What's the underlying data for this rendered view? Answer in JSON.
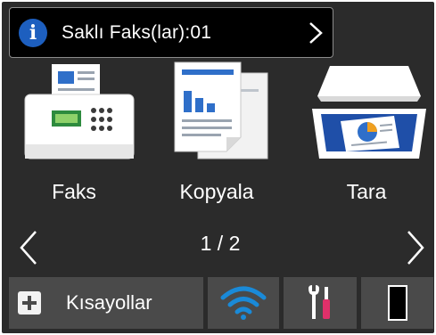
{
  "notification": {
    "icon": "info-icon",
    "text": "Saklı Faks(lar):01",
    "chevron": "chevron-right-icon"
  },
  "apps": [
    {
      "label": "Faks",
      "icon": "fax-icon"
    },
    {
      "label": "Kopyala",
      "icon": "copy-icon"
    },
    {
      "label": "Tara",
      "icon": "scan-icon"
    }
  ],
  "pager": {
    "text": "1 / 2",
    "prev_icon": "chevron-left-icon",
    "next_icon": "chevron-right-icon"
  },
  "bottom_bar": {
    "shortcuts_label": "Kısayollar",
    "shortcuts_icon": "plus-icon",
    "wifi_icon": "wifi-icon",
    "tools_icon": "tools-icon",
    "ink_icon": "ink-level-icon"
  },
  "colors": {
    "background": "#2b2b2b",
    "button": "#4a4a4a",
    "info_blue": "#1d5fbf",
    "wifi_blue": "#1a8ad8",
    "tools_pink": "#e0306a"
  }
}
